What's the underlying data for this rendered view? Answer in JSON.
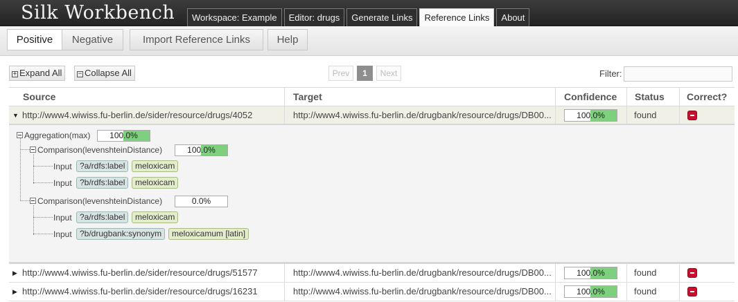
{
  "app": {
    "title": "Silk Workbench"
  },
  "nav": {
    "tabs": [
      {
        "label": "Workspace: Example",
        "active": false
      },
      {
        "label": "Editor: drugs",
        "active": false
      },
      {
        "label": "Generate Links",
        "active": false
      },
      {
        "label": "Reference Links",
        "active": true
      },
      {
        "label": "About",
        "active": false
      }
    ]
  },
  "subtoolbar": {
    "positive": "Positive",
    "negative": "Negative",
    "import": "Import Reference Links",
    "help": "Help"
  },
  "controls": {
    "expand_all": "Expand All",
    "collapse_all": "Collapse All",
    "prev": "Prev",
    "page": "1",
    "next": "Next",
    "filter_label": "Filter:",
    "filter_value": ""
  },
  "table": {
    "headers": {
      "source": "Source",
      "target": "Target",
      "confidence": "Confidence",
      "status": "Status",
      "correct": "Correct?"
    },
    "rows": [
      {
        "source": "http://www4.wiwiss.fu-berlin.de/sider/resource/drugs/4052",
        "target": "http://www4.wiwiss.fu-berlin.de/drugbank/resource/drugs/DB00...",
        "confidence": "100.0%",
        "confidence_value": 1.0,
        "status": "found",
        "expanded": true
      },
      {
        "source": "http://www4.wiwiss.fu-berlin.de/sider/resource/drugs/51577",
        "target": "http://www4.wiwiss.fu-berlin.de/drugbank/resource/drugs/DB00...",
        "confidence": "100.0%",
        "confidence_value": 1.0,
        "status": "found",
        "expanded": false
      },
      {
        "source": "http://www4.wiwiss.fu-berlin.de/sider/resource/drugs/16231",
        "target": "http://www4.wiwiss.fu-berlin.de/drugbank/resource/drugs/DB00...",
        "confidence": "100.0%",
        "confidence_value": 1.0,
        "status": "found",
        "expanded": false
      }
    ]
  },
  "detail": {
    "aggregation": {
      "label": "Aggregation(max)",
      "score": "100.0%",
      "score_value": 1.0
    },
    "comparisons": [
      {
        "label": "Comparison(levenshteinDistance)",
        "score": "100.0%",
        "score_value": 1.0,
        "inputs": [
          {
            "label": "Input",
            "path": "?a/rdfs:label",
            "value": "meloxicam"
          },
          {
            "label": "Input",
            "path": "?b/rdfs:label",
            "value": "meloxicam"
          }
        ]
      },
      {
        "label": "Comparison(levenshteinDistance)",
        "score": "0.0%",
        "score_value": 0.0,
        "inputs": [
          {
            "label": "Input",
            "path": "?a/rdfs:label",
            "value": "meloxicam"
          },
          {
            "label": "Input",
            "path": "?b/drugbank:synonym",
            "value": "meloxicamum [latin]"
          }
        ]
      }
    ]
  },
  "colors": {
    "confidence_fill": "#7ed07e",
    "remove_button": "#c8102e",
    "header_bg": "#2b2b2b"
  },
  "icons": {
    "remove": "remove-icon",
    "expand": "expand-arrow-icon",
    "collapse": "collapse-arrow-icon",
    "tree_toggle": "tree-collapse-icon"
  }
}
